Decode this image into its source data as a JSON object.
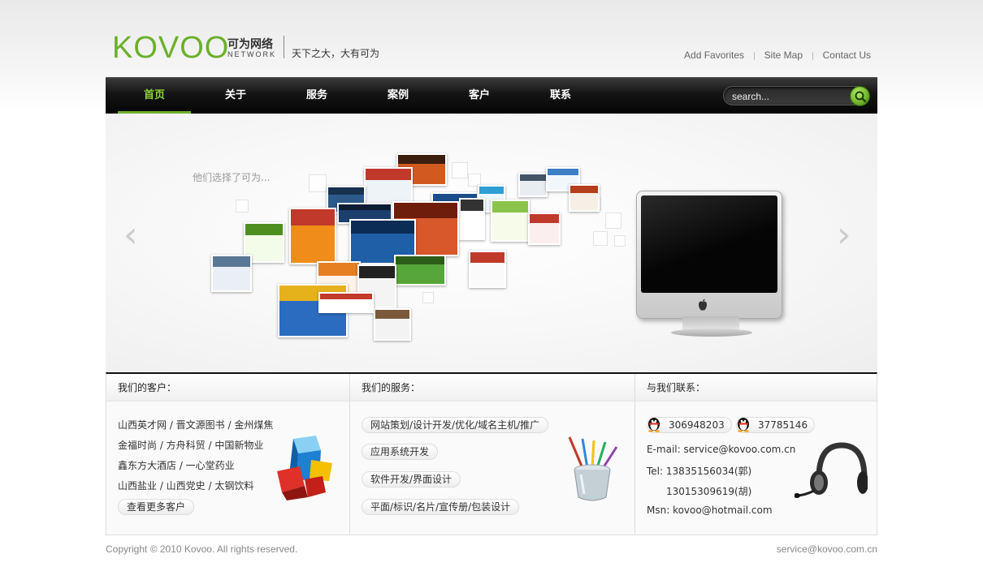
{
  "header": {
    "logo_text": "KOVOO",
    "logo_cn": "可为网络",
    "logo_sub": "NETWORK",
    "slogan": "天下之大，大有可为",
    "links": [
      "Add Favorites",
      "Site Map",
      "Contact Us"
    ],
    "link_separator": "|"
  },
  "nav": {
    "items": [
      "首页",
      "关于",
      "服务",
      "案例",
      "客户",
      "联系"
    ],
    "active_index": 0,
    "search_placeholder": "search...",
    "search_icon": "magnifier-icon"
  },
  "hero": {
    "caption": "他们选择了可为...",
    "arrow_left": "‹",
    "arrow_right": "›",
    "monitor_logo": ""
  },
  "clients": {
    "title": "我们的客户：",
    "rows": [
      "山西英才网 / 晋文源图书 / 金州煤焦",
      "金福时尚 / 方舟科贸 / 中国新物业",
      "鑫东方大酒店 / 一心堂药业",
      "山西盐业 / 山西党史 / 太钢饮料"
    ],
    "more_button": "查看更多客户"
  },
  "services": {
    "title": "我们的服务：",
    "items": [
      "网站策划/设计开发/优化/域名主机/推广",
      "应用系统开发",
      "软件开发/界面设计",
      "平面/标识/名片/宣传册/包装设计"
    ]
  },
  "contact": {
    "title": "与我们联系：",
    "qq": [
      "306948203",
      "37785146"
    ],
    "email": "E-mail: service@kovoo.com.cn",
    "tel": "Tel: 13835156034(郭)",
    "tel2": "13015309619(胡)",
    "msn": "Msn: kovoo@hotmail.com"
  },
  "footer": {
    "copyright": "Copyright © 2010 Kovoo. All rights reserved.",
    "email": "service@kovoo.com.cn"
  },
  "colors": {
    "brand_green": "#6bb02a",
    "nav_active": "#8ed43a",
    "nav_bg": "#111111"
  }
}
